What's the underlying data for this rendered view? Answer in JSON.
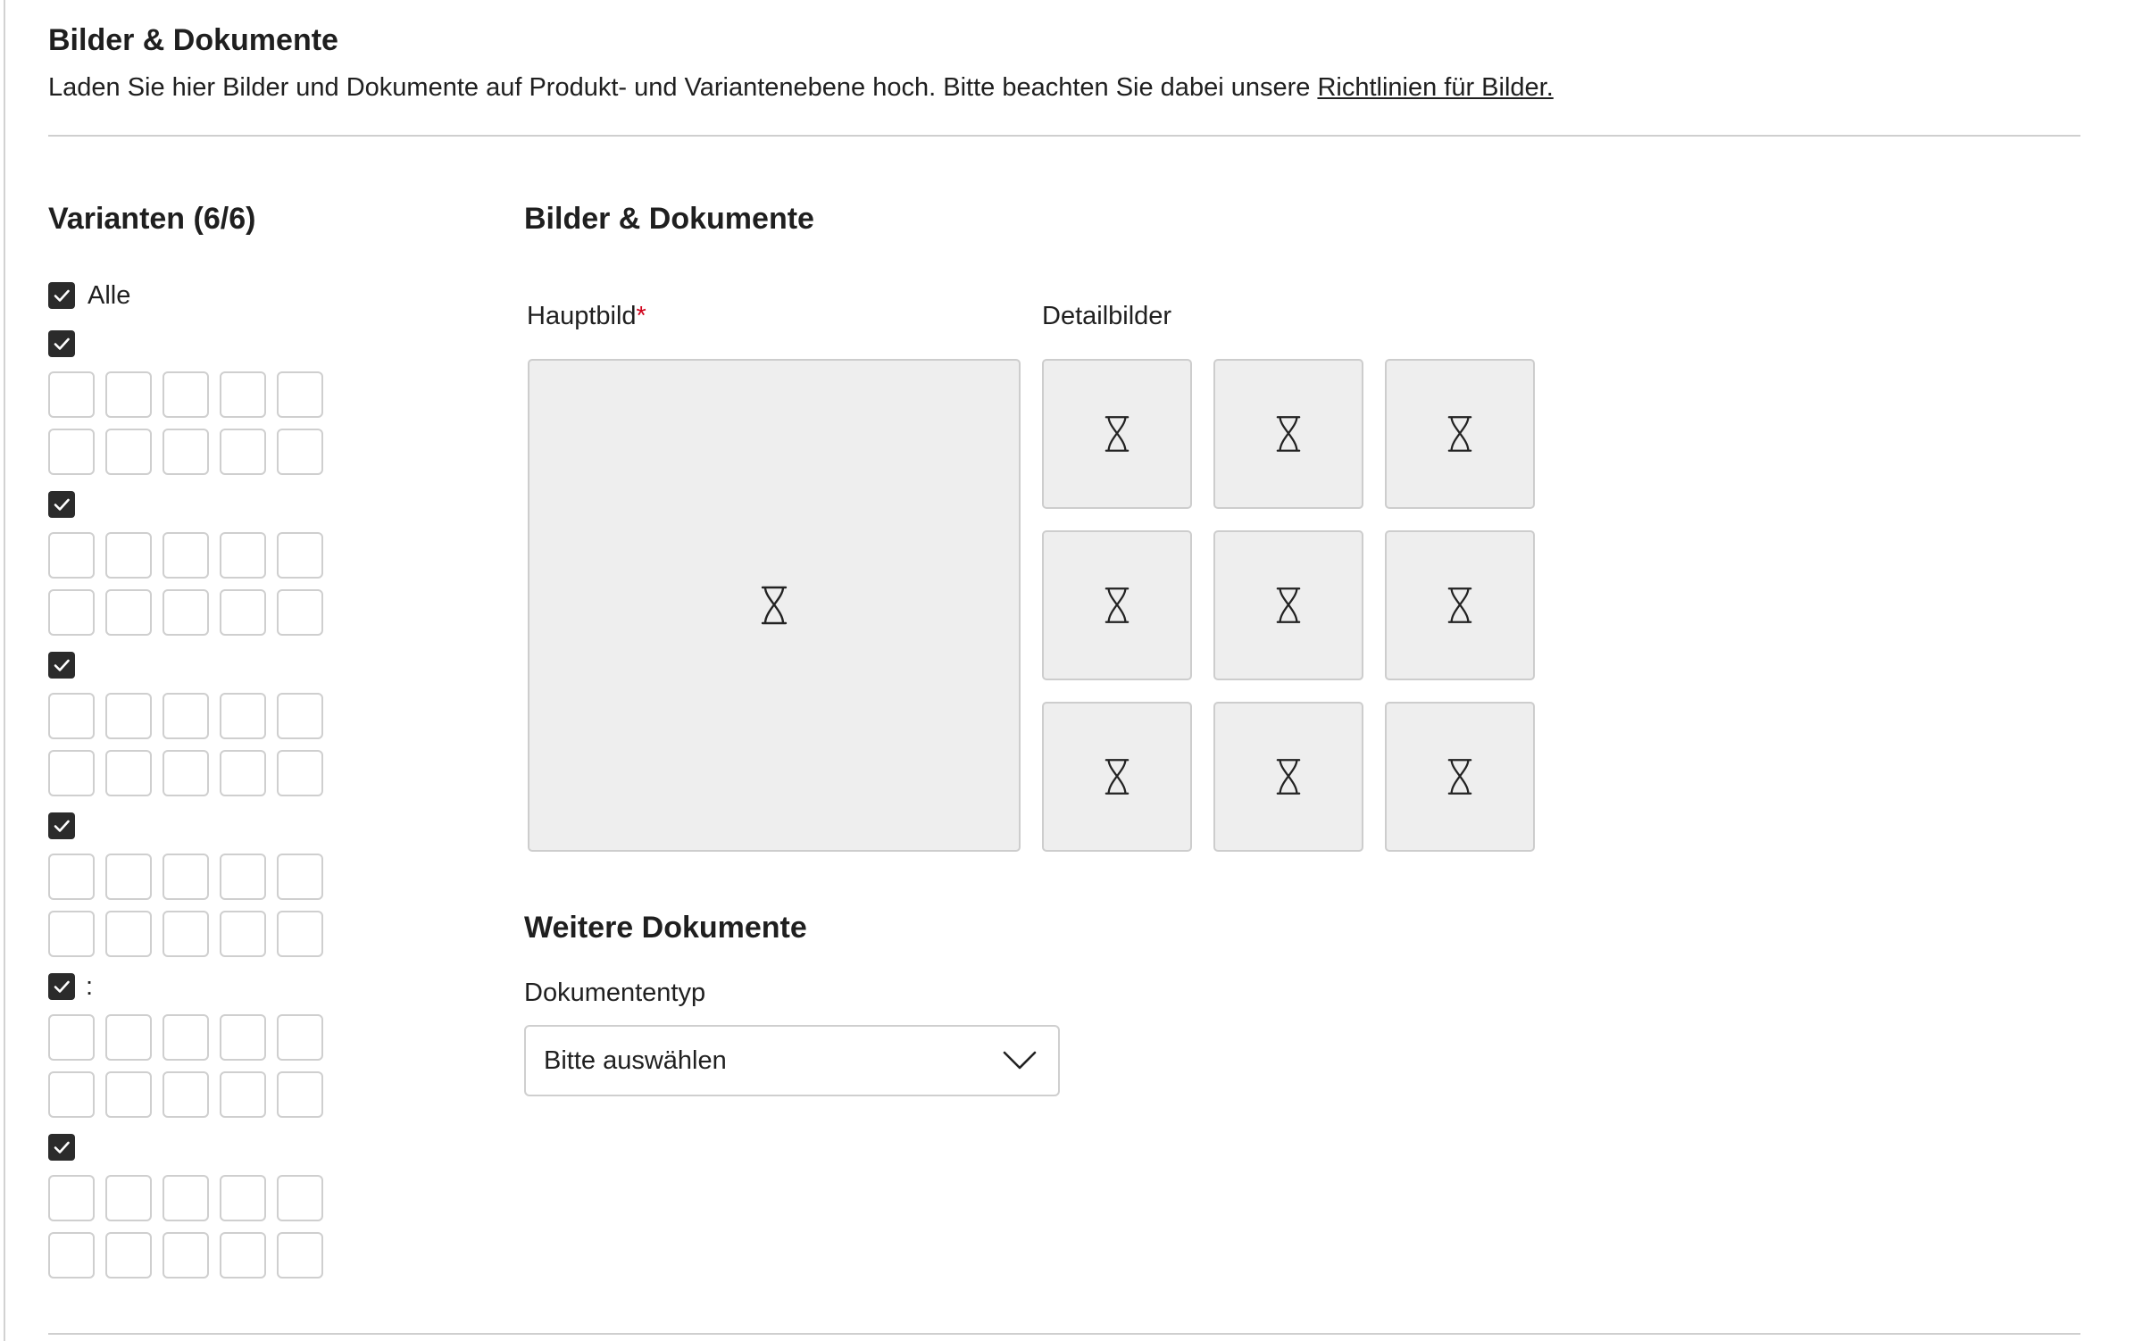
{
  "section": {
    "title": "Bilder & Dokumente",
    "description": "Laden Sie hier Bilder und Dokumente auf Produkt- und Variantenebene hoch. Bitte beachten Sie dabei unsere ",
    "link_label": "Richtlinien für Bilder."
  },
  "variants": {
    "title": "Varianten (6/6)",
    "all_label": "Alle",
    "all_checked": true,
    "groups": [
      {
        "checked": true,
        "label": ""
      },
      {
        "checked": true,
        "label": ""
      },
      {
        "checked": true,
        "label": ""
      },
      {
        "checked": true,
        "label": ""
      },
      {
        "checked": true,
        "label": ":"
      },
      {
        "checked": true,
        "label": ""
      }
    ]
  },
  "media": {
    "title": "Bilder & Dokumente",
    "main_image_label": "Hauptbild",
    "required_marker": "*",
    "detail_images_label": "Detailbilder",
    "loading_icon": "hourglass-icon"
  },
  "documents": {
    "title": "Weitere Dokumente",
    "type_label": "Dokumententyp",
    "type_value": "Bitte auswählen"
  },
  "colors": {
    "checkbox": "#2b2b2b",
    "required": "#d0021b",
    "placeholder_bg": "#eeeeee",
    "border": "#cfcfcf"
  }
}
